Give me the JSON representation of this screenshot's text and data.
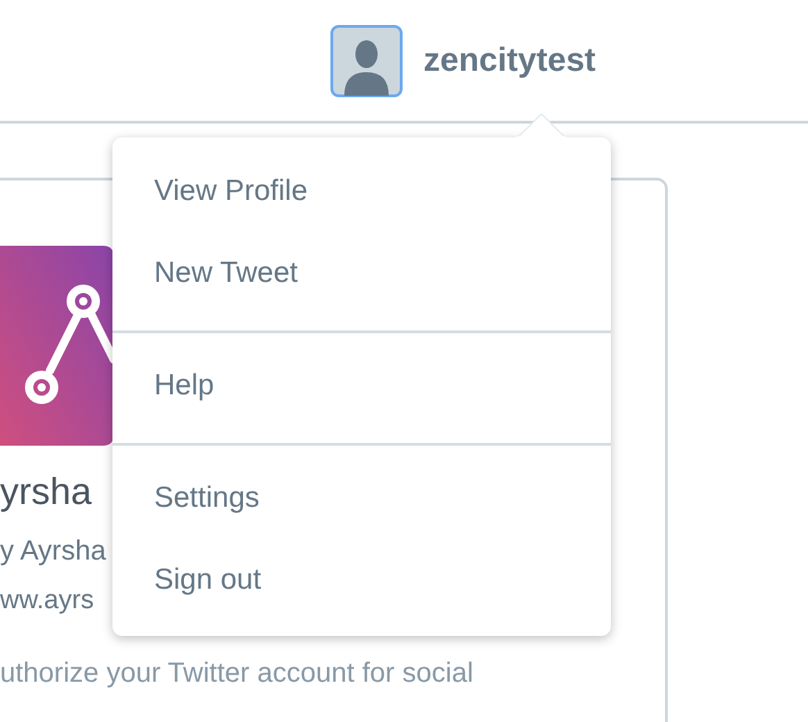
{
  "header": {
    "username": "zencitytest"
  },
  "card": {
    "app_name": "yrsha",
    "developer": "y Ayrsha",
    "website": "ww.ayrs",
    "description": "uthorize your Twitter account for social"
  },
  "dropdown": {
    "groups": [
      [
        "View Profile",
        "New Tweet"
      ],
      [
        "Help"
      ],
      [
        "Settings",
        "Sign out"
      ]
    ]
  }
}
